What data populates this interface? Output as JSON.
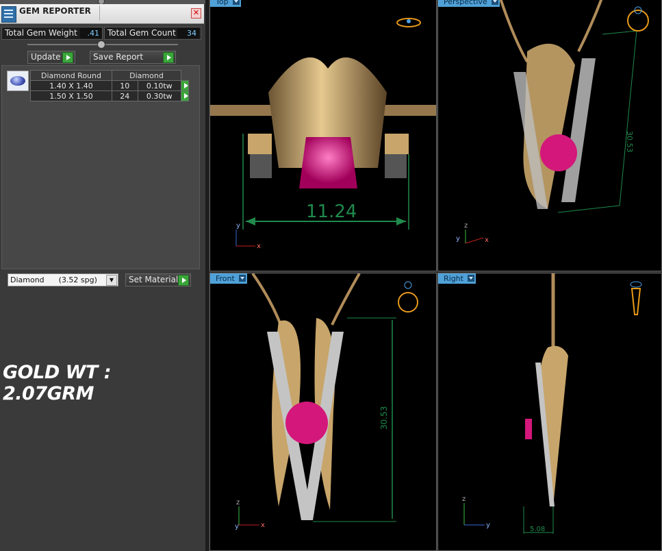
{
  "panel": {
    "title": "GEM REPORTER",
    "total_gem_weight_label": "Total Gem Weight",
    "total_gem_weight_value": ".41",
    "total_gem_count_label": "Total Gem Count",
    "total_gem_count_value": "34",
    "update_label": "Update",
    "save_report_label": "Save Report",
    "table": {
      "headers": [
        "Diamond Round",
        "Diamond"
      ],
      "rows": [
        {
          "size": "1.40 X 1.40",
          "count": "10",
          "weight": "0.10tw"
        },
        {
          "size": "1.50 X 1.50",
          "count": "24",
          "weight": "0.30tw"
        }
      ]
    },
    "material_value": "Diamond      (3.52 spg)",
    "set_material_label": "Set Material",
    "gold_weight_note": "GOLD WT : 2.07GRM"
  },
  "viewports": {
    "top": {
      "label": "Top",
      "dimension": "11.24"
    },
    "perspective": {
      "label": "Perspective",
      "dimension": "30.53"
    },
    "front": {
      "label": "Front",
      "dimension": "30.53"
    },
    "right": {
      "label": "Right",
      "dimension": "5.08"
    }
  },
  "axes": {
    "x": "x",
    "y": "y",
    "z": "z"
  },
  "colors": {
    "tab": "#4fa1d8",
    "gold": "#c8a56a",
    "ruby": "#d4177a",
    "dim": "#1f8a4c"
  }
}
